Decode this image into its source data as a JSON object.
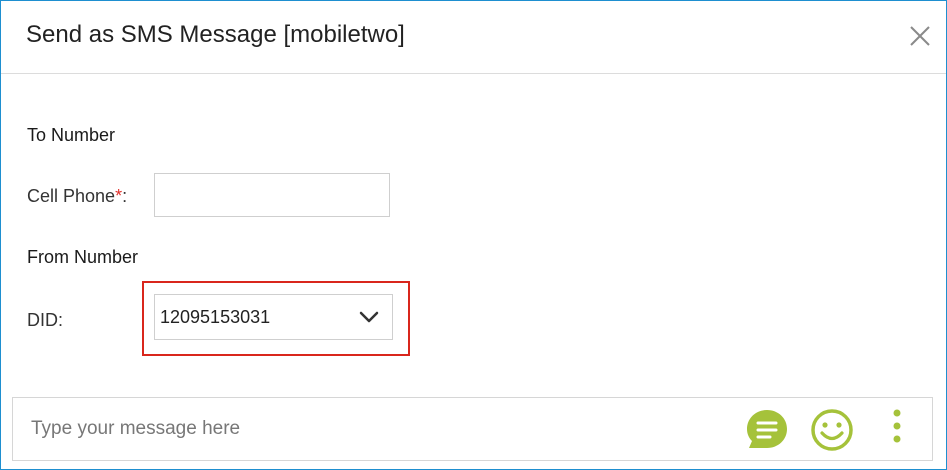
{
  "dialog": {
    "title": "Send as SMS Message [mobiletwo]",
    "close_icon": "close-icon"
  },
  "to_section": {
    "heading": "To Number",
    "cell_phone_label": "Cell Phone",
    "required_marker": "*",
    "label_suffix": ":",
    "cell_phone_value": ""
  },
  "from_section": {
    "heading": "From Number",
    "did_label": "DID:",
    "did_selected": "12095153031",
    "dropdown_icon": "chevron-down-icon"
  },
  "composer": {
    "placeholder": "Type your message here",
    "icons": [
      "message-templates-icon",
      "emoji-icon",
      "more-options-icon"
    ]
  },
  "colors": {
    "dialog_border": "#1e8fd0",
    "highlight_border": "#d9261c",
    "required": "#e0302b",
    "accent_green": "#a5c23a"
  }
}
